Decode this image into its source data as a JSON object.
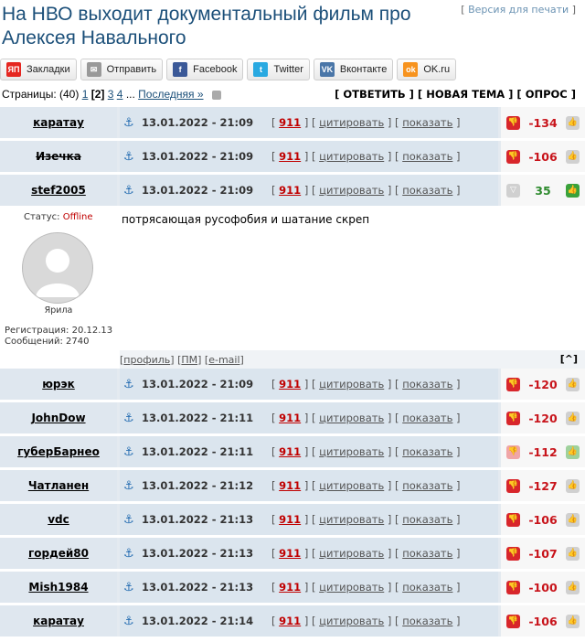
{
  "title": "На НВО выходит документальный фильм про Алексея Навального",
  "print_link": "Версия для печати",
  "share": [
    {
      "label": "Закладки",
      "icon": "yandex-bookmarks-icon",
      "color": "#e52620",
      "glyph": "ЯП"
    },
    {
      "label": "Отправить",
      "icon": "envelope-icon",
      "color": "#999999",
      "glyph": "✉"
    },
    {
      "label": "Facebook",
      "icon": "facebook-icon",
      "color": "#3b5998",
      "glyph": "f"
    },
    {
      "label": "Twitter",
      "icon": "twitter-icon",
      "color": "#29a9e1",
      "glyph": "t"
    },
    {
      "label": "Вконтакте",
      "icon": "vk-icon",
      "color": "#4a76a8",
      "glyph": "VK"
    },
    {
      "label": "OK.ru",
      "icon": "odnoklassniki-icon",
      "color": "#f7931e",
      "glyph": "ok"
    }
  ],
  "pager": {
    "label": "Страницы:",
    "count": "(40)",
    "pages": [
      "1",
      "[2]",
      "3",
      "4"
    ],
    "ellipsis": "...",
    "last": "Последняя »"
  },
  "actions": "[ ОТВЕТИТЬ ] [ НОВАЯ ТЕМА ] [ ОПРОС ]",
  "posts": [
    {
      "author": "каратау",
      "strike": false,
      "datetime": "13.01.2022 - 21:09",
      "score": "-134",
      "type": "neg"
    },
    {
      "author": "Изечка",
      "strike": true,
      "datetime": "13.01.2022 - 21:09",
      "score": "-106",
      "type": "neg"
    },
    {
      "author": "stef2005",
      "strike": false,
      "datetime": "13.01.2022 - 21:09",
      "score": "35",
      "type": "pos"
    },
    {
      "author": "юрэк",
      "strike": false,
      "datetime": "13.01.2022 - 21:09",
      "score": "-120",
      "type": "neg"
    },
    {
      "author": "JohnDow",
      "strike": false,
      "datetime": "13.01.2022 - 21:11",
      "score": "-120",
      "type": "neg"
    },
    {
      "author": "губерБарнео",
      "strike": false,
      "datetime": "13.01.2022 - 21:11",
      "score": "-112",
      "type": "mixed"
    },
    {
      "author": "Чатланен",
      "strike": false,
      "datetime": "13.01.2022 - 21:12",
      "score": "-127",
      "type": "neg"
    },
    {
      "author": "vdc",
      "strike": false,
      "datetime": "13.01.2022 - 21:13",
      "score": "-106",
      "type": "neg"
    },
    {
      "author": "гордей80",
      "strike": false,
      "datetime": "13.01.2022 - 21:13",
      "score": "-107",
      "type": "neg"
    },
    {
      "author": "Mish1984",
      "strike": false,
      "datetime": "13.01.2022 - 21:13",
      "score": "-100",
      "type": "neg"
    },
    {
      "author": "каратау",
      "strike": false,
      "datetime": "13.01.2022 - 21:14",
      "score": "-106",
      "type": "neg"
    }
  ],
  "post_links": {
    "l911": "911",
    "cite": "цитировать",
    "show": "показать"
  },
  "expanded": {
    "status_label": "Статус:",
    "status_value": "Offline",
    "username": "Ярила",
    "reg": "Регистрация: 20.12.13",
    "msgs": "Сообщений: 2740",
    "text": "потрясающая русофобия и шатание скреп",
    "profile": "профиль",
    "pm": "ПМ",
    "email": "e-mail",
    "up": "[^]"
  }
}
